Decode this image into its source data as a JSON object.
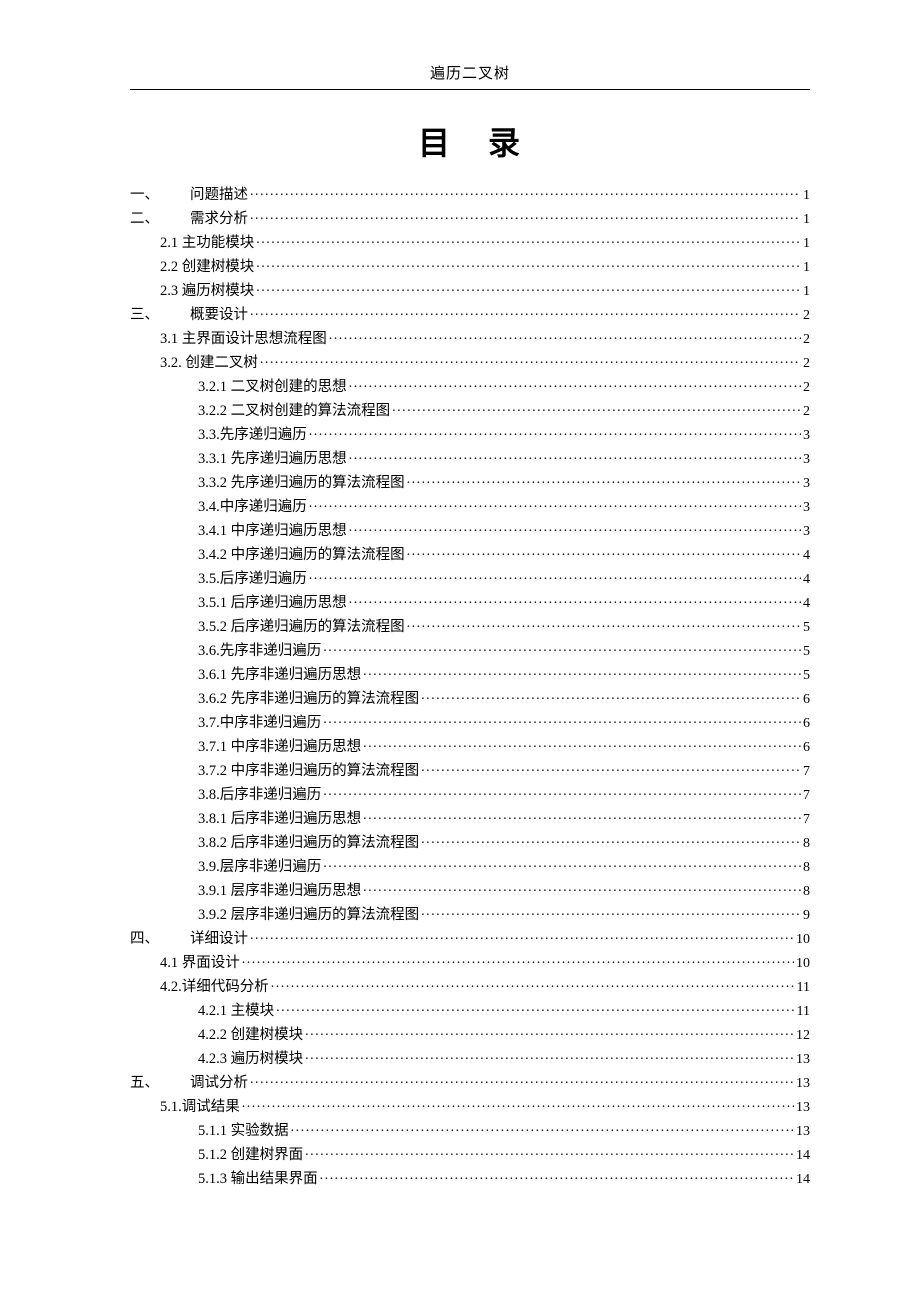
{
  "header": "遍历二叉树",
  "title_a": "目",
  "title_b": "录",
  "toc": [
    {
      "level": 1,
      "num": "一、",
      "label": "问题描述",
      "page": "1"
    },
    {
      "level": 1,
      "num": "二、",
      "label": "需求分析",
      "page": "1"
    },
    {
      "level": 2,
      "num": "",
      "label": "2.1 主功能模块",
      "page": "1"
    },
    {
      "level": 2,
      "num": "",
      "label": "2.2 创建树模块",
      "page": "1"
    },
    {
      "level": 2,
      "num": "",
      "label": "2.3 遍历树模块",
      "page": "1"
    },
    {
      "level": 1,
      "num": "三、",
      "label": "概要设计",
      "page": "2"
    },
    {
      "level": 2,
      "num": "",
      "label": "3.1 主界面设计思想流程图",
      "page": "2"
    },
    {
      "level": 2,
      "num": "",
      "label": "3.2. 创建二叉树",
      "page": "2"
    },
    {
      "level": 3,
      "num": "",
      "label": "3.2.1 二叉树创建的思想",
      "page": "2"
    },
    {
      "level": 3,
      "num": "",
      "label": "3.2.2 二叉树创建的算法流程图",
      "page": "2"
    },
    {
      "level": 3,
      "num": "",
      "label": "3.3.先序递归遍历",
      "page": "3"
    },
    {
      "level": 3,
      "num": "",
      "label": "3.3.1 先序递归遍历思想",
      "page": "3"
    },
    {
      "level": 3,
      "num": "",
      "label": "3.3.2 先序递归遍历的算法流程图",
      "page": "3"
    },
    {
      "level": 3,
      "num": "",
      "label": "3.4.中序递归遍历",
      "page": "3"
    },
    {
      "level": 3,
      "num": "",
      "label": "3.4.1 中序递归遍历思想",
      "page": "3"
    },
    {
      "level": 3,
      "num": "",
      "label": "3.4.2 中序递归遍历的算法流程图",
      "page": "4"
    },
    {
      "level": 3,
      "num": "",
      "label": "3.5.后序递归遍历",
      "page": "4"
    },
    {
      "level": 3,
      "num": "",
      "label": "3.5.1 后序递归遍历思想",
      "page": "4"
    },
    {
      "level": 3,
      "num": "",
      "label": "3.5.2 后序递归遍历的算法流程图",
      "page": "5"
    },
    {
      "level": 3,
      "num": "",
      "label": "3.6.先序非递归遍历",
      "page": "5"
    },
    {
      "level": 3,
      "num": "",
      "label": "3.6.1 先序非递归遍历思想",
      "page": "5"
    },
    {
      "level": 3,
      "num": "",
      "label": "3.6.2 先序非递归遍历的算法流程图",
      "page": "6"
    },
    {
      "level": 3,
      "num": "",
      "label": "3.7.中序非递归遍历",
      "page": "6"
    },
    {
      "level": 3,
      "num": "",
      "label": "3.7.1 中序非递归遍历思想",
      "page": "6"
    },
    {
      "level": 3,
      "num": "",
      "label": "3.7.2 中序非递归遍历的算法流程图",
      "page": "7"
    },
    {
      "level": 3,
      "num": "",
      "label": "3.8.后序非递归遍历",
      "page": "7"
    },
    {
      "level": 3,
      "num": "",
      "label": "3.8.1 后序非递归遍历思想",
      "page": "7"
    },
    {
      "level": 3,
      "num": "",
      "label": "3.8.2 后序非递归遍历的算法流程图",
      "page": "8"
    },
    {
      "level": 3,
      "num": "",
      "label": "3.9.层序非递归遍历",
      "page": "8"
    },
    {
      "level": 3,
      "num": "",
      "label": "3.9.1 层序非递归遍历思想",
      "page": "8"
    },
    {
      "level": 3,
      "num": "",
      "label": "3.9.2 层序非递归遍历的算法流程图",
      "page": "9"
    },
    {
      "level": 1,
      "num": "四、",
      "label": "详细设计",
      "page": "10"
    },
    {
      "level": 2,
      "num": "",
      "label": "4.1 界面设计",
      "page": "10"
    },
    {
      "level": 2,
      "num": "",
      "label": "4.2.详细代码分析",
      "page": "11"
    },
    {
      "level": 3,
      "num": "",
      "label": "4.2.1 主模块",
      "page": "11"
    },
    {
      "level": 3,
      "num": "",
      "label": "4.2.2 创建树模块",
      "page": "12"
    },
    {
      "level": 3,
      "num": "",
      "label": "4.2.3 遍历树模块",
      "page": "13"
    },
    {
      "level": 1,
      "num": "五、",
      "label": "调试分析",
      "page": "13"
    },
    {
      "level": 2,
      "num": "",
      "label": "5.1.调试结果",
      "page": "13"
    },
    {
      "level": 3,
      "num": "",
      "label": "5.1.1 实验数据",
      "page": "13"
    },
    {
      "level": 3,
      "num": "",
      "label": "5.1.2 创建树界面",
      "page": "14"
    },
    {
      "level": 3,
      "num": "",
      "label": "5.1.3 输出结果界面",
      "page": "14"
    }
  ]
}
